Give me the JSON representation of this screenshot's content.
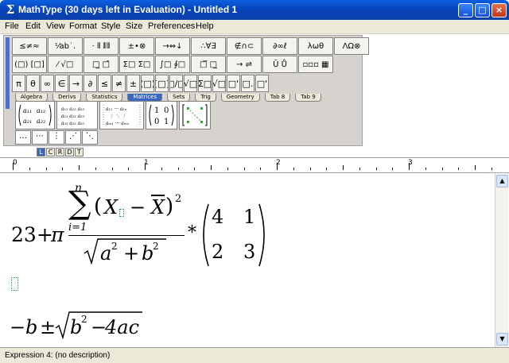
{
  "window": {
    "title": "MathType (30 days left in Evaluation) - Untitled 1",
    "icon": "sigma-icon"
  },
  "window_buttons": {
    "minimize": "_",
    "maximize": "□",
    "close": "×"
  },
  "menu": [
    "File",
    "Edit",
    "View",
    "Format",
    "Style",
    "Size",
    "Preferences",
    "Help"
  ],
  "toolbar": {
    "row1": [
      "≤≠≈",
      "⅟ab˙.",
      "⋅ ⦀ ⦀⦀",
      "±•⊗",
      "→⇔↓",
      "∴∀∃",
      "∉∩⊂",
      "∂∞ℓ",
      "λωθ",
      "ΛΩ⊗"
    ],
    "row2": [
      "(□) [□]",
      "⁄ √□",
      "□̲ □̄",
      "Σ□ Σ□",
      "∫□ ∮□",
      "□̅ □̲",
      "→ ⇌",
      "Ū Ů",
      "▫▫▫ ▦"
    ],
    "row3": [
      "π",
      "θ",
      "∞",
      "∈",
      "→",
      "∂",
      "≤",
      "≠",
      "±",
      "(□)",
      "[□]",
      "□/□",
      "√□",
      "Σ□",
      "√□",
      "□'",
      "□.",
      "□'"
    ],
    "tabs": [
      "Algebra",
      "Derivs",
      "Statistics",
      "Matrices",
      "Sets",
      "Trig",
      "Geometry",
      "Tab 8",
      "Tab 9"
    ],
    "active_tab": "Matrices",
    "templates": [
      "a11 a12 / a21 a22",
      "a11 a12 a13 / a21 a22 a23 / a31 a32 a33",
      "a11 … a1n / ⋮ ⋱ ⋮ / am1 … amn",
      "(1 0 / 0 1)",
      "⁝ ⁝ ⁝ matrix"
    ],
    "small": [
      "…",
      "⋯",
      "⋮",
      "⋰",
      "⋱"
    ]
  },
  "tabstops": [
    "L",
    "C",
    "R",
    "D",
    "T"
  ],
  "ruler": {
    "labels": [
      "0",
      "1",
      "2",
      "3"
    ]
  },
  "equation": {
    "term1": "23",
    "plus": "+",
    "pi": "π",
    "sum": "∑",
    "upper": "n",
    "lower": "i=1",
    "paren_open": "(",
    "X": "X",
    "minus": "−",
    "Xbar": "X",
    "paren_close": ")",
    "exp2": "2",
    "sqrt_a": "a",
    "exp_a": "2",
    "plus2": "+",
    "b": "b",
    "exp_b": "2",
    "times": "*",
    "m11": "4",
    "m12": "1",
    "m21": "2",
    "m22": "3"
  },
  "equation2": {
    "neg": "−",
    "b": "b",
    "pm": "±",
    "b2": "b",
    "exp": "2",
    "minus": "−",
    "rest": "4ac"
  },
  "status": "Expression 4: (no description)"
}
